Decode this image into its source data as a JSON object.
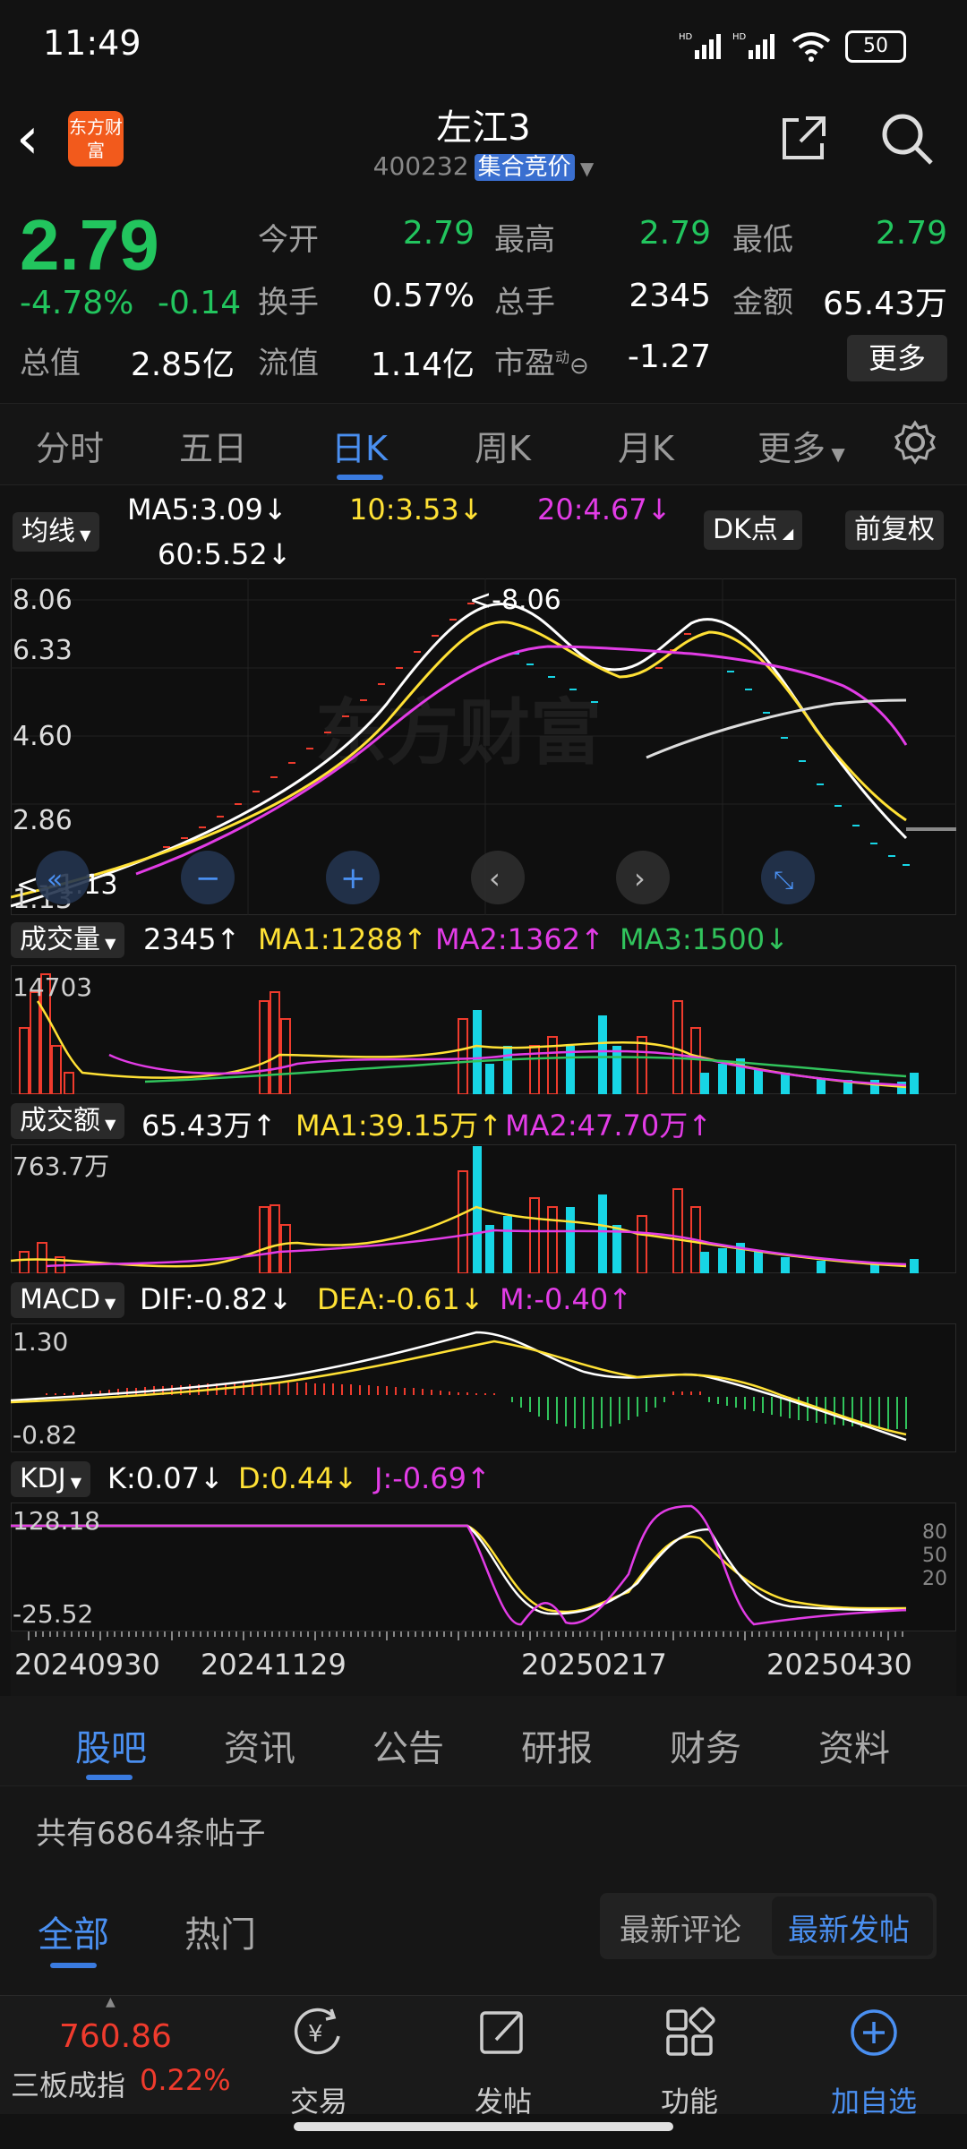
{
  "status_bar": {
    "time": "11:49",
    "battery": "50"
  },
  "header": {
    "logo_text": "东方财富",
    "title": "左江3",
    "code": "400232",
    "badge": "集合竞价"
  },
  "quote": {
    "price": "2.79",
    "change_pct": "-4.78%",
    "change": "-0.14",
    "open_label": "今开",
    "open": "2.79",
    "high_label": "最高",
    "high": "2.79",
    "low_label": "最低",
    "low": "2.79",
    "turnover_label": "换手",
    "turnover": "0.57%",
    "volume_label": "总手",
    "volume": "2345",
    "amount_label": "金额",
    "amount": "65.43万",
    "mktcap_label": "总值",
    "mktcap": "2.85亿",
    "float_label": "流值",
    "float": "1.14亿",
    "pe_label": "市盈",
    "pe_sup": "动",
    "pe": "-1.27",
    "more": "更多"
  },
  "tabs": [
    "分时",
    "五日",
    "日K",
    "周K",
    "月K",
    "更多"
  ],
  "active_tab": "日K",
  "ma_row": {
    "btn": "均线",
    "ma5": "MA5:3.09↓",
    "ma10": "10:3.53↓",
    "ma20": "20:4.67↓",
    "ma60": "60:5.52↓",
    "dk": "DK点",
    "fq": "前复权"
  },
  "kline_axis": {
    "y1": "8.06",
    "y2": "6.33",
    "y3": "4.60",
    "y4": "2.86",
    "y5": "1.13",
    "max_label": "<-8.06",
    "min_label": "<--1.13"
  },
  "volume": {
    "btn": "成交量",
    "val": "2345↑",
    "ma1": "MA1:1288↑",
    "ma2": "MA2:1362↑",
    "ma3": "MA3:1500↓",
    "axis": "14703"
  },
  "amount_ind": {
    "btn": "成交额",
    "val": "65.43万↑",
    "ma1": "MA1:39.15万↑",
    "ma2": "MA2:47.70万↑",
    "axis": "763.7万"
  },
  "macd": {
    "btn": "MACD",
    "dif": "DIF:-0.82↓",
    "dea": "DEA:-0.61↓",
    "m": "M:-0.40↑",
    "axis_top": "1.30",
    "axis_bot": "-0.82"
  },
  "kdj": {
    "btn": "KDJ",
    "k": "K:0.07↓",
    "d": "D:0.44↓",
    "j": "J:-0.69↑",
    "axis_top": "128.18",
    "axis_bot": "-25.52",
    "r80": "80",
    "r50": "50",
    "r20": "20"
  },
  "dates": [
    "20240930",
    "20241129",
    "20250217",
    "20250430"
  ],
  "forum_tabs": [
    "股吧",
    "资讯",
    "公告",
    "研报",
    "财务",
    "资料"
  ],
  "posts_count": "共有6864条帖子",
  "filter_tabs": [
    "全部",
    "热门"
  ],
  "sort_buttons": [
    "最新评论",
    "最新发帖"
  ],
  "bottom_nav": {
    "index_value": "760.86",
    "index_name": "三板成指",
    "index_pct": "0.22%",
    "items": [
      "交易",
      "发帖",
      "功能",
      "加自选"
    ]
  },
  "colors": {
    "down": "#22c55e",
    "up": "#ef3b2d",
    "accent": "#3a7be0",
    "cyan": "#17d5e5",
    "yellow": "#ffe135",
    "magenta": "#e23ce6"
  }
}
